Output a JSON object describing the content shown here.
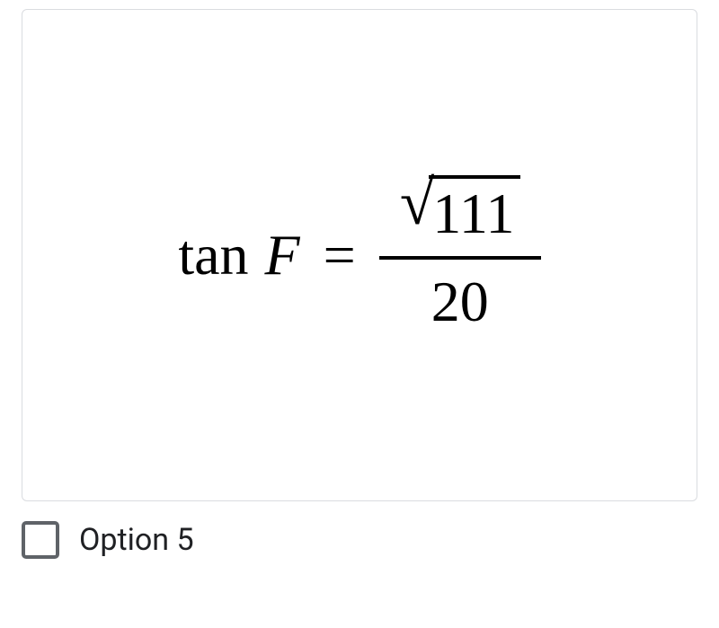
{
  "option": {
    "label": "Option 5",
    "checked": false,
    "equation": {
      "func": "tan",
      "variable": "F",
      "equals": "=",
      "numerator_radicand": "111",
      "denominator": "20",
      "sqrt_symbol": "√"
    }
  }
}
